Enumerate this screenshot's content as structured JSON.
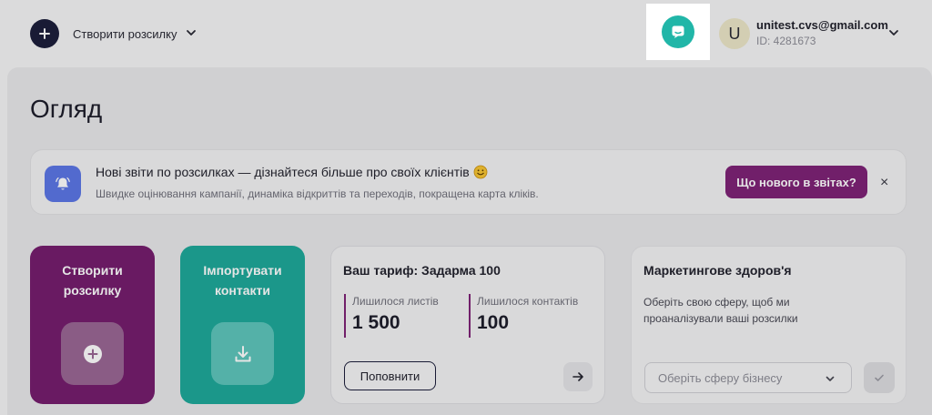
{
  "topbar": {
    "create_label": "Створити розсилку",
    "account_initial": "U",
    "account_email": "unitest.cvs@gmail.com",
    "account_id": "ID: 4281673"
  },
  "page": {
    "title": "Огляд"
  },
  "banner": {
    "title": "Нові звіти по розсилках — дізнайтеся більше про своїх клієнтів",
    "subtitle": "Швидке оцінювання кампанії, динаміка відкриттів та переходів, покращена карта кліків.",
    "button_label": "Що нового в звітах?",
    "close_glyph": "×"
  },
  "cards": {
    "create_label": "Створити розсилку",
    "import_label": "Імпортувати контакти"
  },
  "tariff": {
    "title": "Ваш тариф: Задарма 100",
    "letters_label": "Лишилося листів",
    "letters_value": "1 500",
    "contacts_label": "Лишилося контактів",
    "contacts_value": "100",
    "topup_label": "Поповнити",
    "arrow_glyph": "→"
  },
  "health": {
    "title": "Маркетингове здоров'я",
    "description": "Оберіть свою сферу, щоб ми проаналізували ваші розсилки",
    "select_placeholder": "Оберіть сферу бізнесу"
  },
  "colors": {
    "brand_purple": "#751e6e",
    "accent_teal": "#1fa99a",
    "help_teal": "#21b6a8",
    "bell_blue": "#5c77e6",
    "navy": "#1c1f3b"
  },
  "icons": {
    "create": "plus-icon",
    "help": "chat-support-icon",
    "bell": "bell-icon",
    "import": "download-icon",
    "confirm": "check-icon"
  }
}
